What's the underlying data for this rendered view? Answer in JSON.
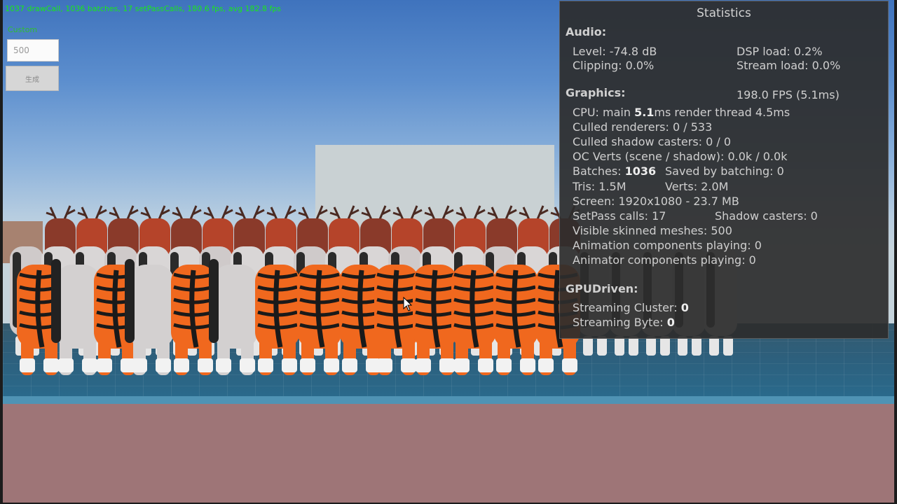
{
  "overlay": {
    "stats_line": "1037 drawCall, 1036 batches, 17 setPassCalls, 180.6 fps, avg 182.8 fps",
    "custom_label": "Custom",
    "count_value": "500",
    "generate_button_label": "生成"
  },
  "stats": {
    "title": "Statistics",
    "audio": {
      "heading": "Audio:",
      "level": "Level: -74.8 dB",
      "clipping": "Clipping: 0.0%",
      "dsp_load": "DSP load: 0.2%",
      "stream_load": "Stream load: 0.0%"
    },
    "graphics": {
      "heading": "Graphics:",
      "fps": "198.0 FPS (5.1ms)",
      "cpu_prefix": "CPU: main ",
      "cpu_main": "5.1",
      "cpu_suffix": "ms  render thread 4.5ms",
      "culled_renderers": "Culled renderers: 0 / 533",
      "culled_shadow": "Culled shadow casters: 0 / 0",
      "oc_verts": "OC Verts (scene / shadow): 0.0k / 0.0k",
      "batches_prefix": "Batches: ",
      "batches_value": "1036",
      "saved_batching": "Saved by batching: 0",
      "tris": "Tris: 1.5M",
      "verts": "Verts: 2.0M",
      "screen": "Screen: 1920x1080 - 23.7 MB",
      "setpass": "SetPass calls: 17",
      "shadow_casters": "Shadow casters: 0",
      "visible_skinned": "Visible skinned meshes: 500",
      "animation_components": "Animation components playing: 0",
      "animator_components": "Animator components playing: 0"
    },
    "gpudriven": {
      "heading": "GPUDriven:",
      "cluster_label": "Streaming Cluster: ",
      "cluster_value": "0",
      "byte_label": "Streaming Byte: ",
      "byte_value": "0"
    }
  },
  "colors": {
    "overlay_text": "#19e819",
    "tiger_orange": "#f0681e",
    "deer_white": "#d9d6d6",
    "deer_red": "#b5442a",
    "ground": "#2d5f7c",
    "floor": "#9e7577"
  },
  "icons": [
    "mouse-cursor-icon"
  ]
}
